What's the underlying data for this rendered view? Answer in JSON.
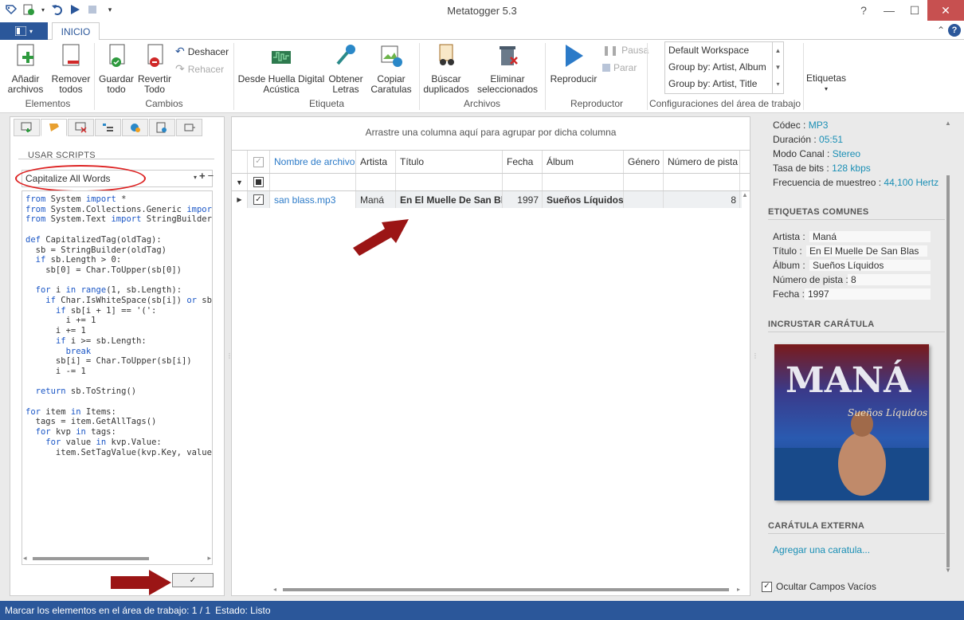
{
  "window": {
    "title": "Metatogger 5.3"
  },
  "tabs": {
    "home": "INICIO"
  },
  "ribbon": {
    "add_files": "Añadir\narchivos",
    "remove_all": "Remover\ntodos",
    "save_all": "Guardar\ntodo",
    "revert_all": "Revertir\nTodo",
    "undo": "Deshacer",
    "redo": "Rehacer",
    "fingerprint": "Desde Huella Digital\nAcústica",
    "lyrics": "Obtener\nLetras",
    "copy_covers": "Copiar\nCaratulas",
    "find_dups": "Búscar\nduplicados",
    "delete_selected": "Eliminar\nseleccionados",
    "play": "Reproducir",
    "pause": "Pausa",
    "stop": "Parar",
    "tags": "Etiquetas",
    "group_elementos": "Elementos",
    "group_cambios": "Cambios",
    "group_etiqueta": "Etiqueta",
    "group_archivos": "Archivos",
    "group_reproductor": "Reproductor",
    "group_config": "Configuraciones del área de trabajo",
    "workspaces": [
      "Default Workspace",
      "Group by: Artist, Album",
      "Group by: Artist, Title"
    ]
  },
  "left": {
    "section_title": "USAR SCRIPTS",
    "selected_script": "Capitalize All Words",
    "code": "from System import *\nfrom System.Collections.Generic import\nfrom System.Text import StringBuilder\n\ndef CapitalizedTag(oldTag):\n  sb = StringBuilder(oldTag)\n  if sb.Length > 0:\n    sb[0] = Char.ToUpper(sb[0])\n\n  for i in range(1, sb.Length):\n    if Char.IsWhiteSpace(sb[i]) or sb[i\n      if sb[i + 1] == '(':\n        i += 1\n      i += 1\n      if i >= sb.Length:\n        break\n      sb[i] = Char.ToUpper(sb[i])\n      i -= 1\n\n  return sb.ToString()\n\nfor item in Items:\n  tags = item.GetAllTags()\n  for kvp in tags:\n    for value in kvp.Value:\n      item.SetTagValue(kvp.Key, value,"
  },
  "center": {
    "group_hint": "Arrastre una columna aquí para agrupar por dicha columna",
    "columns": [
      "Nombre de archivo",
      "Artista",
      "Título",
      "Fecha",
      "Álbum",
      "Género",
      "Número de pista"
    ],
    "row": {
      "filename": "san blass.mp3",
      "artist": "Maná",
      "title": "En El Muelle De San Bl...",
      "date": "1997",
      "album": "Sueños Líquidos",
      "genre": "",
      "track": "8"
    }
  },
  "right": {
    "codec_label": "Códec :",
    "codec": "MP3",
    "duration_label": "Duración :",
    "duration": "05:51",
    "channel_label": "Modo Canal :",
    "channel": "Stereo",
    "bitrate_label": "Tasa de bits :",
    "bitrate": "128 kbps",
    "sample_label": "Frecuencia de muestreo :",
    "sample": "44,100 Hertz",
    "common_tags": "ETIQUETAS COMUNES",
    "artist_label": "Artista :",
    "artist": "Maná",
    "title_label": "Título :",
    "title": "En El Muelle De San Blas",
    "album_label": "Álbum :",
    "album": "Sueños Líquidos",
    "track_label": "Número de pista :",
    "track": "8",
    "date_label": "Fecha :",
    "date": "1997",
    "embed_cover": "INCRUSTAR CARÁTULA",
    "cover_text": "MANÁ",
    "cover_subtext": "Sueños Líquidos",
    "external_cover": "CARÁTULA EXTERNA",
    "add_cover": "Agregar una caratula...",
    "hide_empty": "Ocultar Campos Vacíos"
  },
  "status": {
    "mark": "Marcar los elementos en el área de trabajo: 1 / 1",
    "state": "Estado: Listo"
  },
  "colors": {
    "accent": "#2b579a",
    "link": "#1a8fb5",
    "close": "#c75050",
    "annotation": "#d22222"
  }
}
